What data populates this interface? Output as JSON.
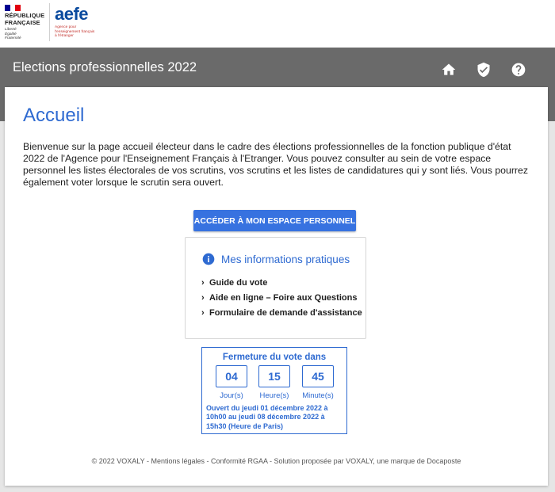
{
  "header": {
    "republique_line1": "RÉPUBLIQUE",
    "republique_line2": "FRANÇAISE",
    "motto_line1": "Liberté",
    "motto_line2": "Égalité",
    "motto_line3": "Fraternité",
    "aefe_word": "aefe",
    "aefe_desc": "Agence pour\nl'enseignement français\nà l'étranger"
  },
  "appbar": {
    "title": "Elections professionnelles 2022",
    "icons": [
      "home-icon",
      "shield-check-icon",
      "help-icon"
    ]
  },
  "main": {
    "title": "Accueil",
    "intro": "Bienvenue sur la page accueil électeur dans le cadre des élections professionnelles de la fonction publique d'état 2022 de l'Agence pour l'Enseignement Français à l'Etranger. Vous pouvez consulter au sein de votre espace personnel les listes électorales de vos scrutins, vos scrutins et les listes de candidatures qui y sont liés. Vous pourrez également voter lorsque le scrutin sera ouvert.",
    "access_button": "ACCÉDER À MON ESPACE PERSONNEL"
  },
  "info": {
    "title": "Mes informations pratiques",
    "links": [
      "Guide du vote",
      "Aide en ligne – Foire aux Questions",
      "Formulaire de demande d'assistance"
    ]
  },
  "countdown": {
    "title": "Fermeture du vote dans",
    "days": "04",
    "days_label": "Jour(s)",
    "hours": "15",
    "hours_label": "Heure(s)",
    "minutes": "45",
    "minutes_label": "Minute(s)",
    "note": "Ouvert du jeudi 01 décembre 2022 à 10h00 au jeudi 08 décembre 2022 à 15h30 (Heure de Paris)"
  },
  "footer": {
    "text": "© 2022 VOXALY - Mentions légales - Conformité RGAA - Solution proposée par VOXALY, une marque de Docaposte"
  },
  "colors": {
    "accent": "#2e6ad1",
    "button": "#3772e0",
    "appbar": "#6a6a6a",
    "background": "#e6e6e6",
    "flag_blue": "#000091",
    "flag_red": "#e1000f",
    "aefe_blue": "#0a4a9e",
    "aefe_red": "#c4342f"
  }
}
